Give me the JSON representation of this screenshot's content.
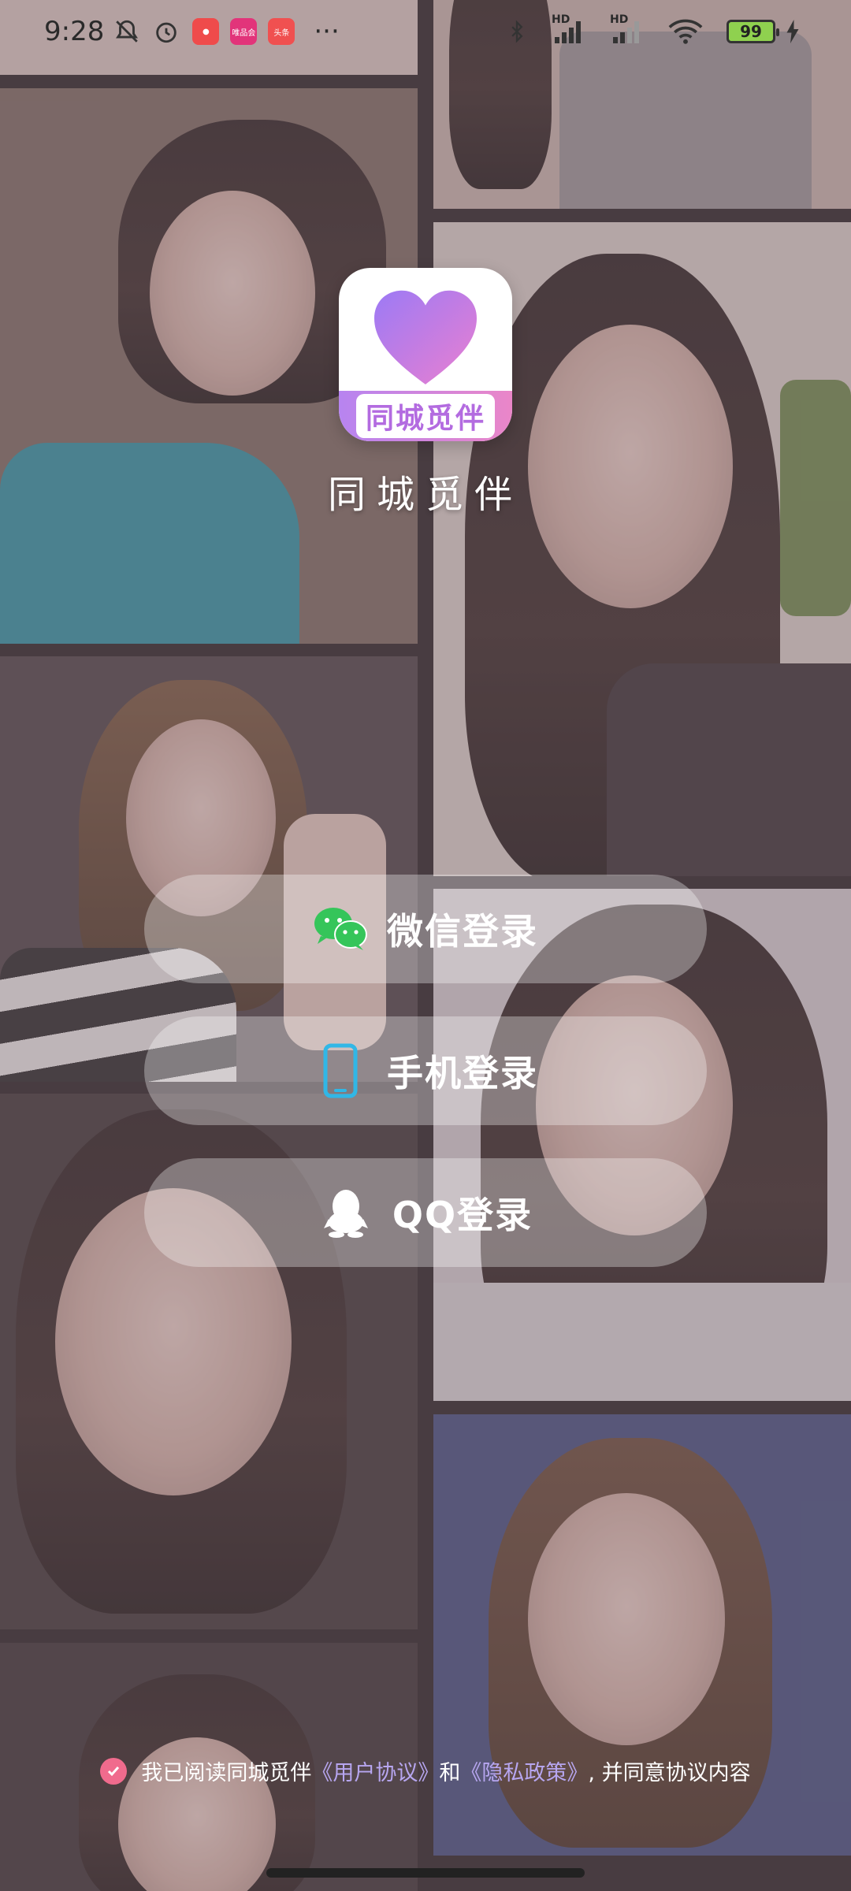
{
  "status_bar": {
    "time": "9:28",
    "left_icons": [
      "mute-bell-icon",
      "alarm-icon",
      "app-notification-icon",
      "app-notification-icon",
      "app-notification-icon"
    ],
    "app_badges": [
      "唯品会",
      "头条"
    ],
    "more": "···",
    "network_labels": [
      "HD",
      "HD"
    ],
    "battery_level": "99"
  },
  "app": {
    "logo_band_text": "同城觅伴",
    "name": "同城觅伴",
    "brand_colors": [
      "#b784f0",
      "#ea86c8"
    ]
  },
  "login": {
    "wechat_label": "微信登录",
    "phone_label": "手机登录",
    "qq_label": "QQ登录"
  },
  "agreement": {
    "checked": true,
    "prefix": "我已阅读同城觅伴",
    "user_agreement": "《用户协议》",
    "and": "和",
    "privacy_policy": "《隐私政策》",
    "suffix": ", 并同意协议内容"
  },
  "background": {
    "description_icon": "photo-collage-background",
    "tile_count": 10
  }
}
